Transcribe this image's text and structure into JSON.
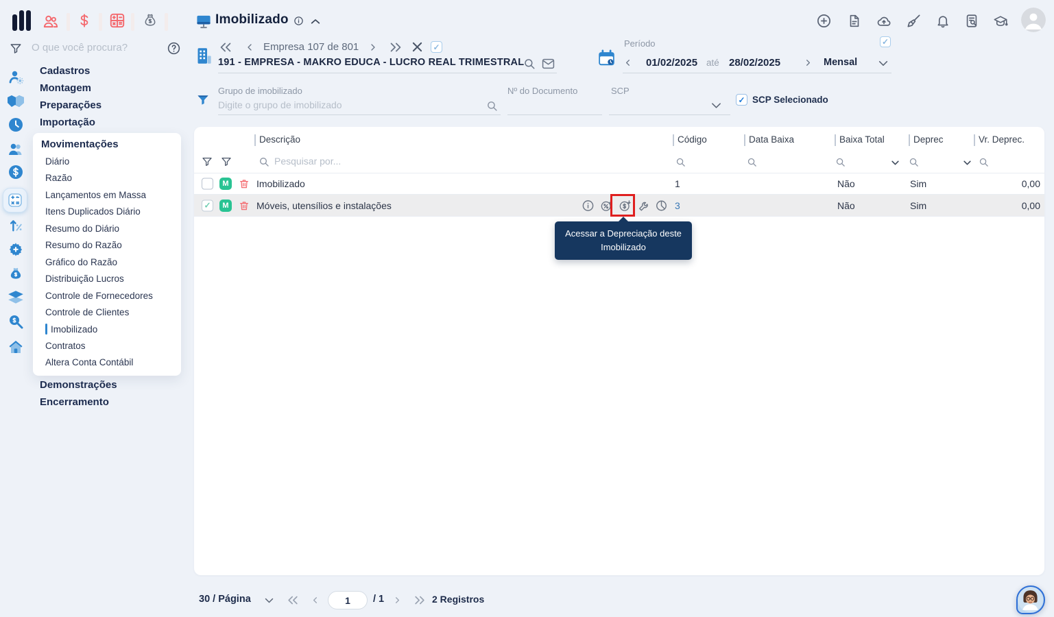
{
  "page": {
    "title": "Imobilizado"
  },
  "search": {
    "placeholder": "O que você procura?"
  },
  "top_nav": {
    "module_icons": [
      "users-icon",
      "currency-icon",
      "calculator-icon",
      "money-bag-icon"
    ],
    "right_icons": [
      "add-icon",
      "new-document-icon",
      "cloud-upload-icon",
      "clean-icon",
      "notifications-icon",
      "document-search-icon",
      "education-icon",
      "user-avatar"
    ]
  },
  "sidebar": {
    "rail_icons": [
      "user-settings-icon",
      "handshake-icon",
      "clock-icon",
      "people-icon",
      "dollar-circle-icon",
      "calculator-icon",
      "growth-percent-icon",
      "gear-icon",
      "money-bag-icon",
      "layers-icon",
      "search-audit-icon",
      "home-icon"
    ],
    "items": [
      "Cadastros",
      "Montagem",
      "Preparações",
      "Importação"
    ],
    "submenu": {
      "title": "Movimentações",
      "items": [
        "Diário",
        "Razão",
        "Lançamentos em Massa",
        "Itens Duplicados Diário",
        "Resumo do Diário",
        "Resumo do Razão",
        "Gráfico do Razão",
        "Distribuição Lucros",
        "Controle de Fornecedores",
        "Controle de Clientes",
        "Imobilizado",
        "Contratos",
        "Altera Conta Contábil"
      ],
      "active_item": "Imobilizado"
    },
    "items_after": [
      "Demonstrações",
      "Encerramento"
    ]
  },
  "company": {
    "pager": "Empresa 107 de 801",
    "name": "191 - EMPRESA - MAKRO EDUCA - LUCRO REAL TRIMESTRAL"
  },
  "period": {
    "label": "Período",
    "start_date": "01/02/2025",
    "separator": "até",
    "end_date": "28/02/2025",
    "interval": "Mensal"
  },
  "filters": {
    "group": {
      "label": "Grupo de imobilizado",
      "placeholder": "Digite o grupo de imobilizado"
    },
    "document": {
      "label": "Nº do Documento",
      "value": ""
    },
    "scp": {
      "label": "SCP",
      "value": ""
    },
    "scp_selected": {
      "label": "SCP Selecionado",
      "checked": true
    }
  },
  "table": {
    "columns": [
      "Descrição",
      "Código",
      "Data Baixa",
      "Baixa Total",
      "Deprec",
      "Vr. Deprec."
    ],
    "search_placeholder": "Pesquisar por...",
    "row_actions": [
      "info-icon",
      "percent-download-icon",
      "money-download-icon",
      "tools-icon",
      "pie-chart-icon"
    ],
    "rows": [
      {
        "selected": false,
        "badge": "M",
        "description": "Imobilizado",
        "codigo": "1",
        "data_baixa": "",
        "baixa_total": "Não",
        "deprec": "Sim",
        "vr_deprec": "0,00"
      },
      {
        "selected": true,
        "badge": "M",
        "description": "Móveis, utensílios e instalações",
        "codigo": "3",
        "data_baixa": "",
        "baixa_total": "Não",
        "deprec": "Sim",
        "vr_deprec": "0,00"
      }
    ],
    "tooltip": "Acessar a Depreciação deste Imobilizado"
  },
  "pagination": {
    "page_size": "30 / Página",
    "current_page": "1",
    "total_pages": "/ 1",
    "records_count": "2 Registros"
  },
  "colors": {
    "accent_blue": "#2f86cf",
    "accent_red": "#f4696e",
    "badge_green": "#29c393",
    "tooltip_bg": "#16375f",
    "highlight_red": "#df1f1f"
  }
}
